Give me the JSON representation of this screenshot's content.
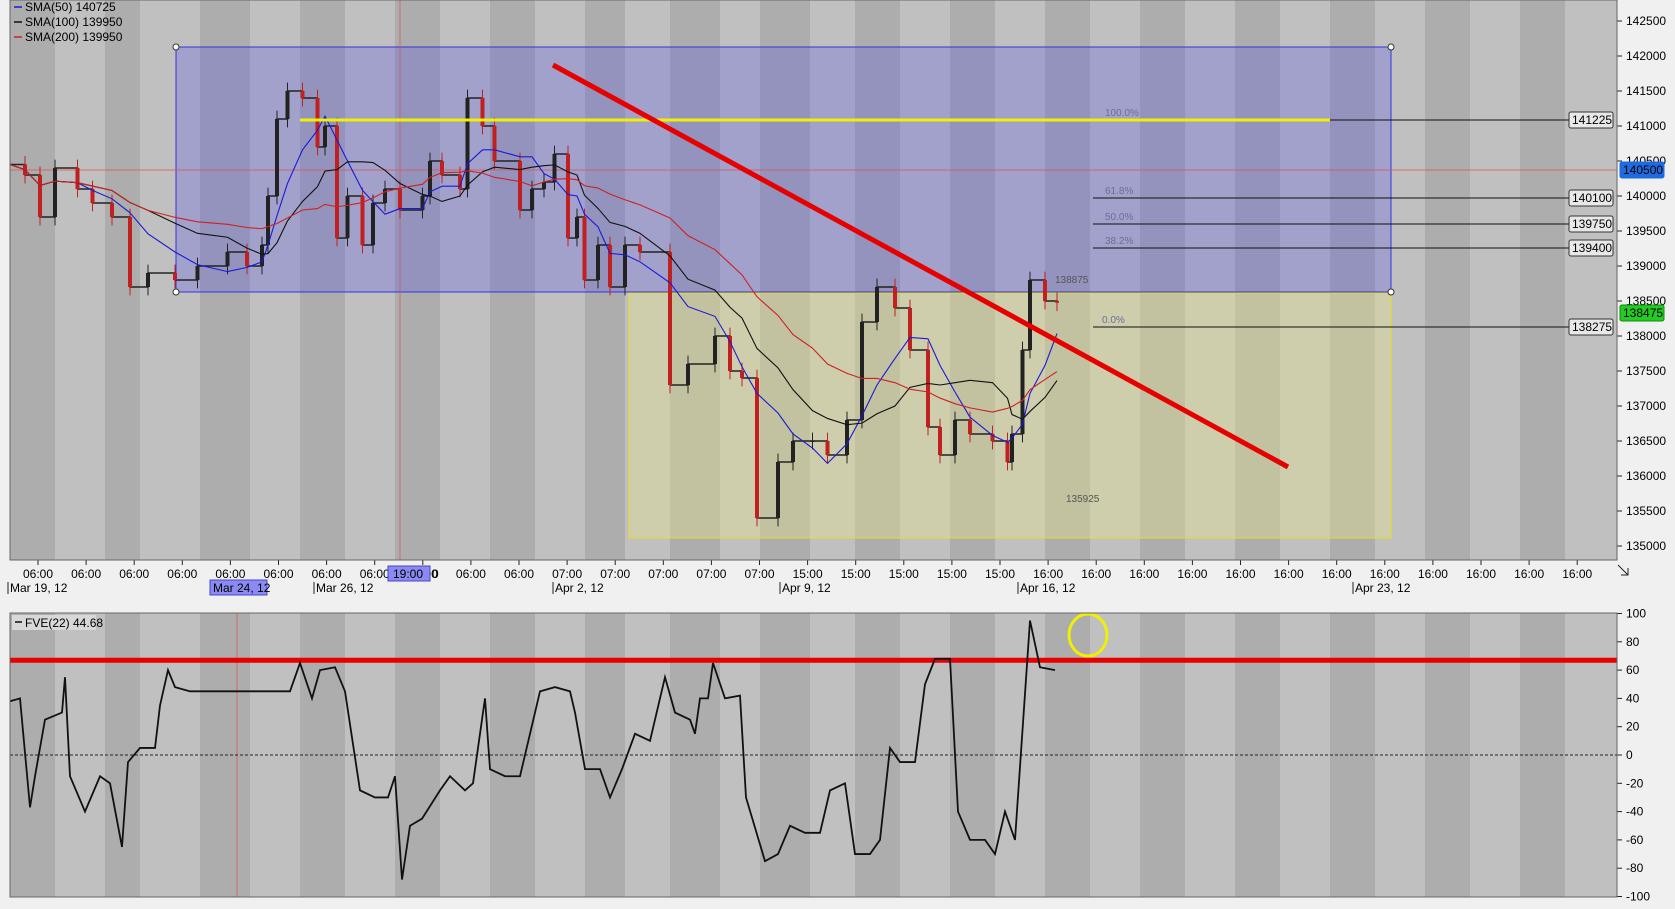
{
  "main_legend": [
    {
      "label": "SMA(50)",
      "value": "140725",
      "color": "#1a1ad8"
    },
    {
      "label": "SMA(100)",
      "value": "139950",
      "color": "#111111"
    },
    {
      "label": "SMA(200)",
      "value": "139950",
      "color": "#cc2222"
    }
  ],
  "indicator_legend": {
    "label": "FVE(22)",
    "value": "44.68"
  },
  "x_time_labels": [
    "06:00",
    "06:00",
    "06:00",
    "06:00",
    "06:00",
    "06:00",
    "06:00",
    "06:00",
    "06:00",
    "06:00",
    "06:00",
    "07:00",
    "07:00",
    "07:00",
    "07:00",
    "07:00",
    "15:00",
    "15:00",
    "15:00",
    "15:00",
    "15:00",
    "16:00",
    "16:00",
    "16:00",
    "16:00",
    "16:00",
    "16:00",
    "16:00",
    "16:00",
    "16:00",
    "16:00",
    "16:00",
    "16:00"
  ],
  "x_date_labels": [
    "Mar 19, 12",
    "Mar 24, 12",
    "Mar 26, 12",
    "Apr 2, 12",
    "Apr 9, 12",
    "Apr 16, 12",
    "Apr 23, 12"
  ],
  "crosshair_x_label": "19:00",
  "crosshair_x_label_partial": "0",
  "crosshair_date_label": "Mar 24, 12",
  "price_axis_labels": [
    "142500",
    "142000",
    "141500",
    "141000",
    "140500",
    "140000",
    "139500",
    "139000",
    "138500",
    "138000",
    "137500",
    "137000",
    "136500",
    "136000",
    "135500",
    "135000"
  ],
  "price_boxes": {
    "fib_100": "141225",
    "crosshair": "140500",
    "fib_618": "140100",
    "fib_50": "139750",
    "fib_382": "139400",
    "last": "138475",
    "fib_0": "138275"
  },
  "fib_labels": [
    "100.0%",
    "61.8%",
    "50.0%",
    "38.2%",
    "0.0%"
  ],
  "swing_labels": {
    "high": "138875",
    "low": "135925"
  },
  "indicator_axis_labels": [
    "100",
    "80",
    "60",
    "40",
    "20",
    "0",
    "-20",
    "-40",
    "-60",
    "-80",
    "-100"
  ],
  "colors": {
    "blue_box": "#3333dd",
    "yellow_box": "#e8e020",
    "trendline": "#e60000",
    "yellow_line": "#f0f000",
    "last_price": "#22cc22",
    "crosshair_box": "#1e6be0"
  },
  "chart_data": [
    {
      "type": "candlestick",
      "title": "",
      "ylim": [
        135000,
        142700
      ],
      "series": [
        {
          "name": "SMA(50)",
          "last": 140725
        },
        {
          "name": "SMA(100)",
          "last": 139950
        },
        {
          "name": "SMA(200)",
          "last": 139950
        }
      ],
      "close_path": [
        [
          0,
          140450
        ],
        [
          10,
          140300
        ],
        [
          20,
          139700
        ],
        [
          30,
          140400
        ],
        [
          45,
          140100
        ],
        [
          55,
          139900
        ],
        [
          68,
          139700
        ],
        [
          80,
          138700
        ],
        [
          92,
          138900
        ],
        [
          110,
          138800
        ],
        [
          125,
          139000
        ],
        [
          145,
          139200
        ],
        [
          158,
          139000
        ],
        [
          168,
          139300
        ],
        [
          172,
          140000
        ],
        [
          178,
          141100
        ],
        [
          185,
          141500
        ],
        [
          195,
          141400
        ],
        [
          205,
          140700
        ],
        [
          210,
          141000
        ],
        [
          218,
          139400
        ],
        [
          225,
          140000
        ],
        [
          235,
          139300
        ],
        [
          242,
          139900
        ],
        [
          250,
          140100
        ],
        [
          260,
          139800
        ],
        [
          275,
          140000
        ],
        [
          280,
          140500
        ],
        [
          288,
          140300
        ],
        [
          300,
          140100
        ],
        [
          305,
          141400
        ],
        [
          315,
          141000
        ],
        [
          323,
          140500
        ],
        [
          340,
          139800
        ],
        [
          348,
          140100
        ],
        [
          356,
          140200
        ],
        [
          363,
          140600
        ],
        [
          372,
          139400
        ],
        [
          378,
          139700
        ],
        [
          383,
          138800
        ],
        [
          392,
          139300
        ],
        [
          400,
          138700
        ],
        [
          410,
          139300
        ],
        [
          420,
          139200
        ],
        [
          440,
          137300
        ],
        [
          452,
          137600
        ],
        [
          470,
          138000
        ],
        [
          480,
          137500
        ],
        [
          488,
          137400
        ],
        [
          498,
          135400
        ],
        [
          512,
          136200
        ],
        [
          522,
          136500
        ],
        [
          535,
          136500
        ],
        [
          545,
          136300
        ],
        [
          558,
          136800
        ],
        [
          568,
          138200
        ],
        [
          578,
          138700
        ],
        [
          590,
          138400
        ],
        [
          600,
          137800
        ],
        [
          612,
          136700
        ],
        [
          620,
          136300
        ],
        [
          630,
          136800
        ],
        [
          640,
          136600
        ],
        [
          655,
          136500
        ],
        [
          665,
          136200
        ],
        [
          668,
          136600
        ],
        [
          675,
          137800
        ],
        [
          680,
          138800
        ],
        [
          690,
          138500
        ],
        [
          698,
          138475
        ]
      ]
    },
    {
      "type": "line",
      "title": "",
      "series_name": "FVE(22)",
      "last": 44.68,
      "ylim": [
        -100,
        100
      ],
      "reference_line": 67,
      "points": [
        [
          0,
          38
        ],
        [
          10,
          40
        ],
        [
          20,
          -37
        ],
        [
          25,
          -15
        ],
        [
          35,
          25
        ],
        [
          52,
          30
        ],
        [
          55,
          55
        ],
        [
          60,
          -15
        ],
        [
          75,
          -40
        ],
        [
          90,
          -15
        ],
        [
          100,
          -20
        ],
        [
          112,
          -65
        ],
        [
          118,
          -5
        ],
        [
          130,
          5
        ],
        [
          145,
          5
        ],
        [
          150,
          35
        ],
        [
          158,
          60
        ],
        [
          165,
          48
        ],
        [
          180,
          45
        ],
        [
          200,
          45
        ],
        [
          220,
          45
        ],
        [
          240,
          45
        ],
        [
          265,
          45
        ],
        [
          280,
          45
        ],
        [
          290,
          65
        ],
        [
          302,
          40
        ],
        [
          310,
          60
        ],
        [
          325,
          62
        ],
        [
          335,
          45
        ],
        [
          350,
          -25
        ],
        [
          365,
          -30
        ],
        [
          378,
          -30
        ],
        [
          385,
          -15
        ],
        [
          392,
          -88
        ],
        [
          400,
          -50
        ],
        [
          412,
          -45
        ],
        [
          430,
          -25
        ],
        [
          440,
          -15
        ],
        [
          455,
          -25
        ],
        [
          463,
          -20
        ],
        [
          475,
          40
        ],
        [
          480,
          -10
        ],
        [
          495,
          -15
        ],
        [
          510,
          -15
        ],
        [
          520,
          15
        ],
        [
          530,
          45
        ],
        [
          545,
          48
        ],
        [
          560,
          45
        ],
        [
          565,
          30
        ],
        [
          575,
          -10
        ],
        [
          590,
          -10
        ],
        [
          600,
          -30
        ],
        [
          612,
          -10
        ],
        [
          625,
          15
        ],
        [
          640,
          10
        ],
        [
          655,
          55
        ],
        [
          665,
          30
        ],
        [
          680,
          25
        ],
        [
          685,
          15
        ],
        [
          690,
          40
        ],
        [
          698,
          40
        ],
        [
          703,
          65
        ],
        [
          715,
          40
        ],
        [
          730,
          42
        ],
        [
          736,
          -30
        ],
        [
          755,
          -75
        ],
        [
          768,
          -70
        ],
        [
          780,
          -50
        ],
        [
          795,
          -55
        ],
        [
          810,
          -55
        ],
        [
          820,
          -25
        ],
        [
          835,
          -20
        ],
        [
          845,
          -70
        ],
        [
          860,
          -70
        ],
        [
          870,
          -60
        ],
        [
          880,
          5
        ],
        [
          890,
          -5
        ],
        [
          905,
          -5
        ],
        [
          915,
          50
        ],
        [
          925,
          68
        ],
        [
          940,
          68
        ],
        [
          948,
          -40
        ],
        [
          960,
          -60
        ],
        [
          975,
          -60
        ],
        [
          985,
          -70
        ],
        [
          995,
          -40
        ],
        [
          1005,
          -60
        ],
        [
          1020,
          95
        ],
        [
          1030,
          62
        ],
        [
          1045,
          60
        ]
      ]
    }
  ]
}
